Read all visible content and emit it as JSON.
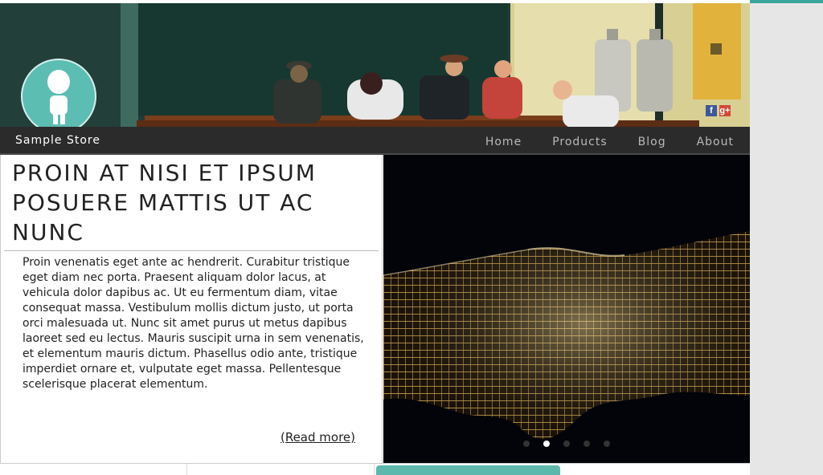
{
  "brand": {
    "name": "Sample Store",
    "accent": "#3aa59a"
  },
  "social": {
    "facebook": "f",
    "google_plus": "g+"
  },
  "nav": {
    "items": [
      {
        "label": "Home"
      },
      {
        "label": "Products"
      },
      {
        "label": "Blog"
      },
      {
        "label": "About"
      }
    ]
  },
  "article": {
    "title": "PROIN AT NISI ET IPSUM POSUERE MATTIS UT AC NUNC",
    "body": "Proin venenatis eget ante ac hendrerit. Curabitur tristique eget diam nec porta. Praesent aliquam dolor lacus, at vehicula dolor dapibus ac. Ut eu fermentum diam, vitae consequat massa. Vestibulum mollis dictum justo, ut porta orci malesuada ut. Nunc sit amet purus ut metus dapibus laoreet sed eu lectus. Mauris suscipit urna in sem venenatis, et elementum mauris dictum. Phasellus odio ante, tristique imperdiet ornare et, vulputate eget massa. Pellentesque scelerisque placerat elementum.",
    "read_more": "(Read more)"
  },
  "slider": {
    "slide_count": 5,
    "active_index": 1
  }
}
